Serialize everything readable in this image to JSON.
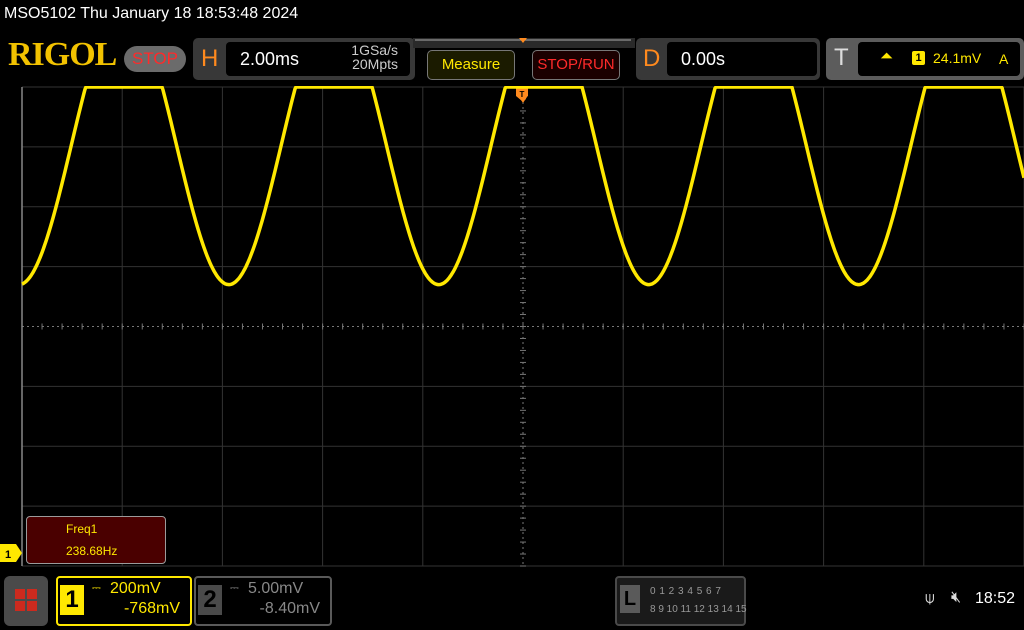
{
  "header": {
    "title": "MSO5102  Thu January 18 18:53:48 2024",
    "logo": "RIGOL",
    "run_state": "STOP"
  },
  "horizontal": {
    "letter": "H",
    "timebase": "2.00ms",
    "sample_rate": "1GSa/s",
    "memory_depth": "20Mpts"
  },
  "buttons": {
    "measure": "Measure",
    "stop_run": "STOP/RUN"
  },
  "delay": {
    "letter": "D",
    "value": "0.00s"
  },
  "trigger": {
    "letter": "T",
    "edge_icon": "rising-edge-icon",
    "edge_glyph": "⏶",
    "source": "1",
    "level": "24.1mV",
    "mode": "A"
  },
  "waveform": {
    "color": "#ffe800",
    "frequency_hz": 238.68,
    "trough_divisions_above_center": 0.7,
    "crest_clipped": true
  },
  "measurement": {
    "label": "Freq1",
    "value": "238.68Hz"
  },
  "ch1": {
    "number": "1",
    "coupling_glyph": "⎓",
    "scale": "200mV",
    "offset": "-768mV",
    "marker": "1",
    "color": "#ffe800"
  },
  "ch2": {
    "number": "2",
    "coupling_glyph": "⎓",
    "scale": "5.00mV",
    "offset": "-8.40mV"
  },
  "logic": {
    "letter": "L",
    "row1": "0 1 2 3  4 5 6 7",
    "row2": "8 9 10 11 12 13 14 15"
  },
  "status": {
    "usb_glyph": "⍦",
    "mute_glyph": "🔇︎",
    "time": "18:52"
  }
}
